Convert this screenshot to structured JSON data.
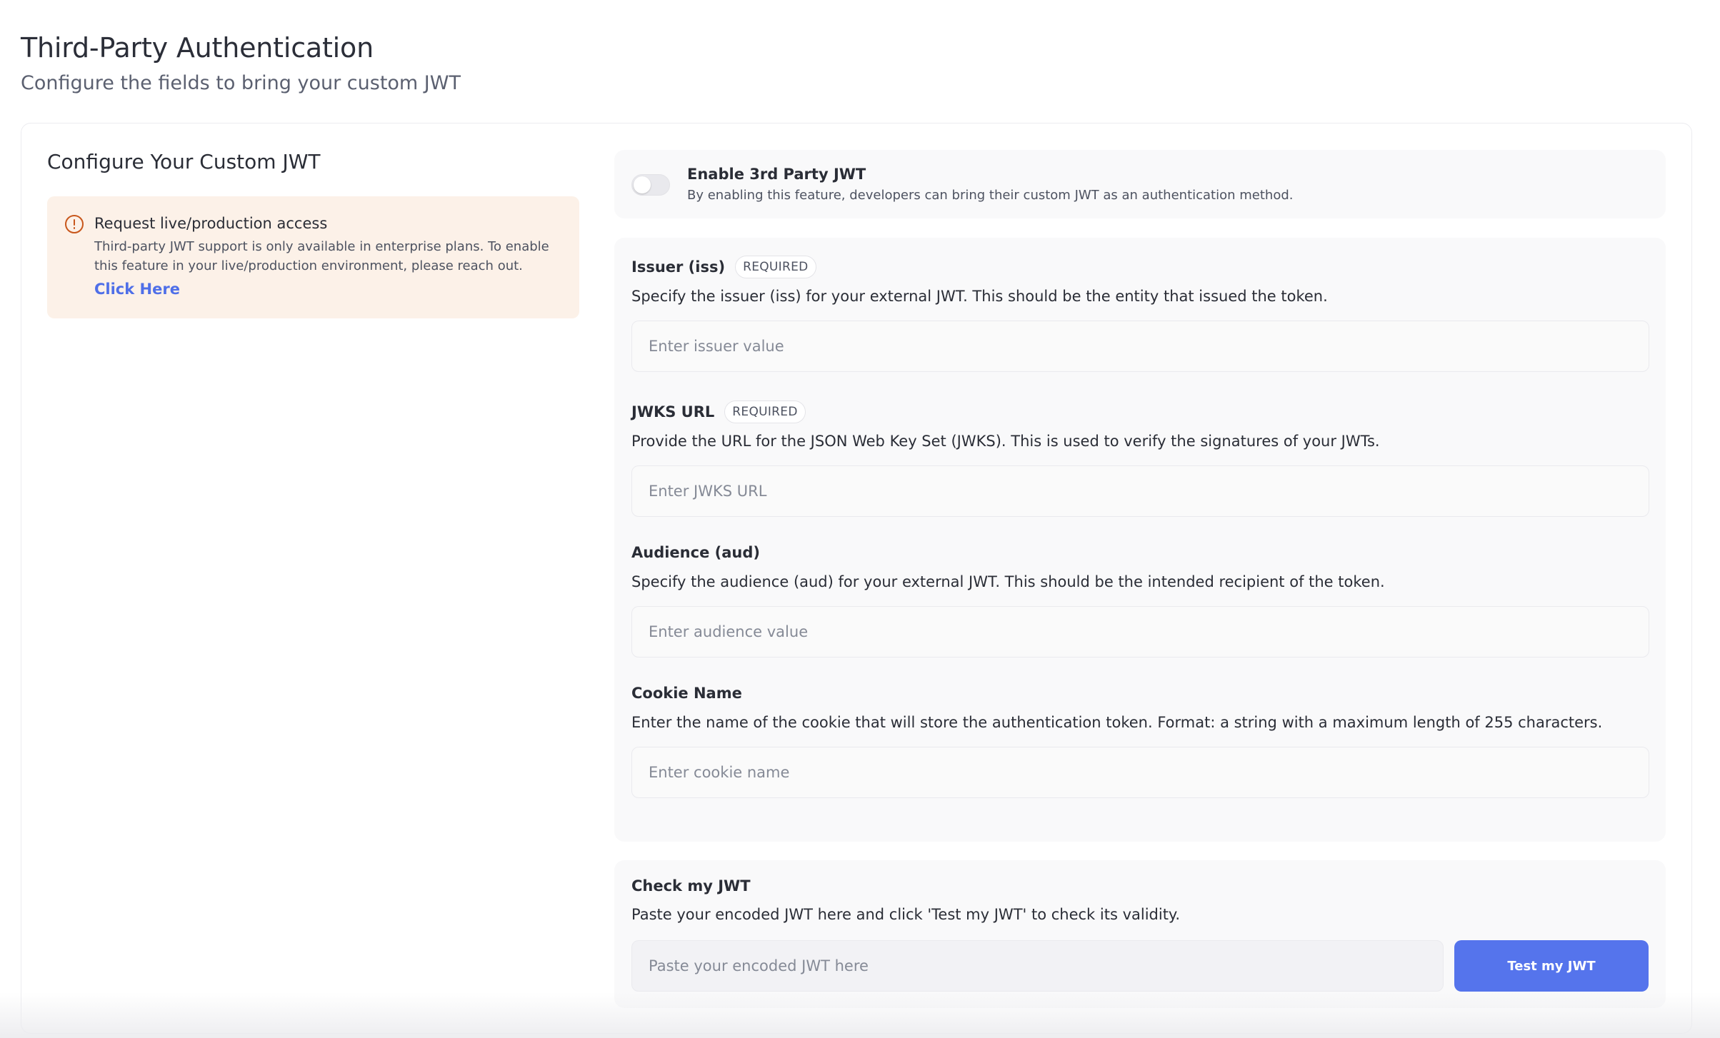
{
  "header": {
    "title": "Third-Party Authentication",
    "subtitle": "Configure the fields to bring your custom JWT"
  },
  "left": {
    "title": "Configure Your Custom JWT",
    "alert": {
      "icon": "alert-circle-icon",
      "title": "Request live/production access",
      "body": "Third-party JWT support is only available in enterprise plans. To enable this feature in your live/production environment, please reach out.",
      "link": "Click Here"
    }
  },
  "toggle": {
    "enabled": false,
    "title": "Enable 3rd Party JWT",
    "description": "By enabling this feature, developers can bring their custom JWT as an authentication method."
  },
  "fields": [
    {
      "label": "Issuer (iss)",
      "badge": "REQUIRED",
      "description": "Specify the issuer (iss) for your external JWT. This should be the entity that issued the token.",
      "placeholder": "Enter issuer value",
      "value": ""
    },
    {
      "label": "JWKS URL",
      "badge": "REQUIRED",
      "description": "Provide the URL for the JSON Web Key Set (JWKS). This is used to verify the signatures of your JWTs.",
      "placeholder": "Enter JWKS URL",
      "value": ""
    },
    {
      "label": "Audience (aud)",
      "badge": "",
      "description": "Specify the audience (aud) for your external JWT. This should be the intended recipient of the token.",
      "placeholder": "Enter audience value",
      "value": ""
    },
    {
      "label": "Cookie Name",
      "badge": "",
      "description": "Enter the name of the cookie that will store the authentication token. Format: a string with a maximum length of 255 characters.",
      "placeholder": "Enter cookie name",
      "value": ""
    }
  ],
  "check": {
    "title": "Check my JWT",
    "description": "Paste your encoded JWT here and click 'Test my JWT' to check its validity.",
    "placeholder": "Paste your encoded JWT here",
    "button": "Test my JWT"
  },
  "colors": {
    "accent": "#5574ec",
    "link": "#4f6fe8",
    "alert_bg": "#fcf1e8",
    "alert_icon": "#c8571c"
  }
}
